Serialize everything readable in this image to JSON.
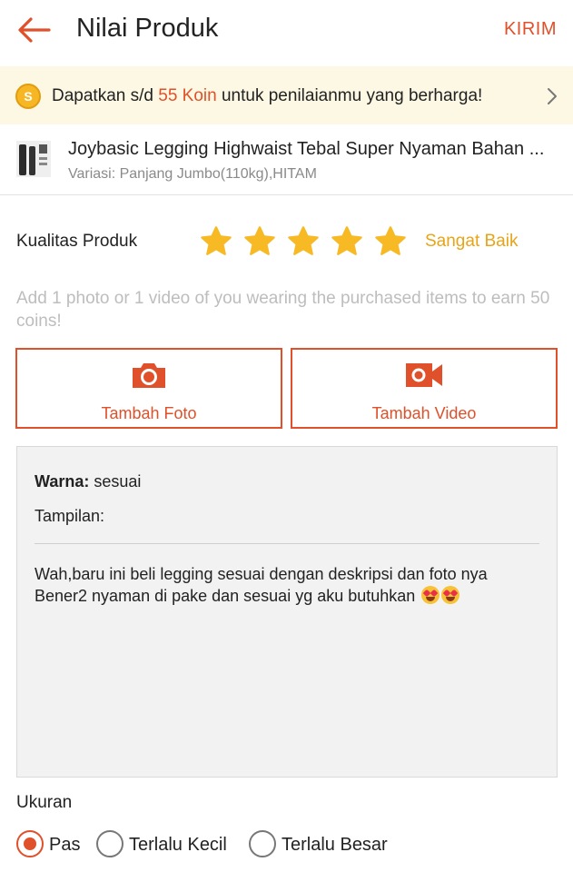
{
  "header": {
    "title": "Nilai Produk",
    "send_label": "KIRIM"
  },
  "promo": {
    "coin_glyph": "S",
    "text_before": "Dapatkan s/d ",
    "highlight": "55 Koin",
    "text_after": " untuk penilaianmu yang berharga!"
  },
  "product": {
    "name": "Joybasic Legging Highwaist Tebal Super Nyaman Bahan ...",
    "variation": "Variasi: Panjang Jumbo(110kg),HITAM"
  },
  "rating": {
    "label": "Kualitas Produk",
    "stars": 5,
    "max_stars": 5,
    "text": "Sangat Baik"
  },
  "hint": "Add 1 photo or 1 video of you wearing the purchased items to earn 50 coins!",
  "media": {
    "photo_label": "Tambah Foto",
    "video_label": "Tambah Video"
  },
  "review": {
    "color_key": "Warna:",
    "color_value": " sesuai",
    "appearance_key": "Tampilan:",
    "line1": "Wah,baru ini beli legging sesuai dengan deskripsi dan foto nya",
    "line2": "Bener2 nyaman di pake dan sesuai yg aku butuhkan "
  },
  "size": {
    "label": "Ukuran",
    "options": [
      {
        "label": "Pas",
        "selected": true
      },
      {
        "label": "Terlalu Kecil",
        "selected": false
      },
      {
        "label": "Terlalu Besar",
        "selected": false
      }
    ]
  },
  "colors": {
    "accent": "#e0502a",
    "star": "#f7b924",
    "rating_text": "#e8a417",
    "promo_bg": "#fdf8e4"
  }
}
